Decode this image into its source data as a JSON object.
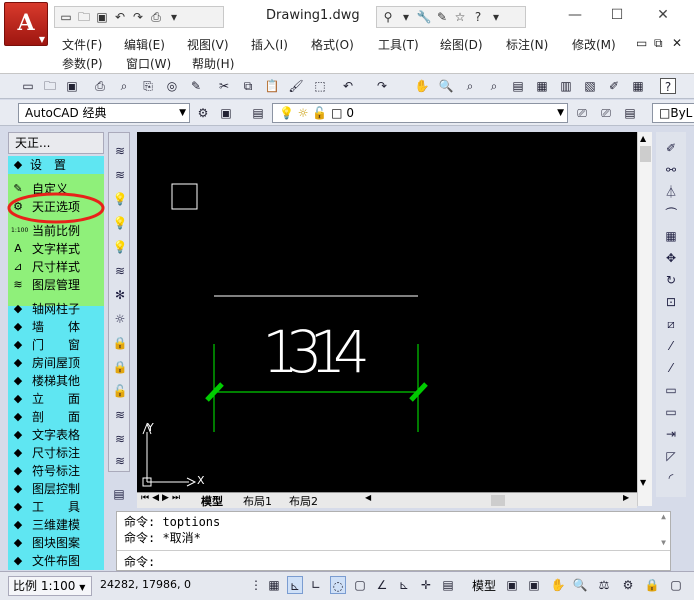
{
  "window": {
    "title": "Drawing1.dwg",
    "logo_letter": "A"
  },
  "menubar": {
    "row1": [
      "文件(F)",
      "编辑(E)",
      "视图(V)",
      "插入(I)",
      "格式(O)",
      "工具(T)",
      "绘图(D)",
      "标注(N)",
      "修改(M)"
    ],
    "row2": [
      "参数(P)",
      "窗口(W)",
      "帮助(H)"
    ]
  },
  "toolbar2": {
    "workspace": "AutoCAD 经典",
    "layer_value": "0",
    "linetype_partial": "ByL"
  },
  "palette": {
    "title": "天正...",
    "items": [
      {
        "label": "设　置",
        "icon": "expand-icon",
        "color": "#5fe6f2"
      },
      {
        "label": "自定义",
        "icon": "customize-icon"
      },
      {
        "label": "天正选项",
        "icon": "options-icon",
        "highlight": true
      },
      {
        "label": "当前比例",
        "icon": "scale-icon"
      },
      {
        "label": "文字样式",
        "icon": "text-style-icon"
      },
      {
        "label": "尺寸样式",
        "icon": "dim-style-icon"
      },
      {
        "label": "图层管理",
        "icon": "layer-manage-icon"
      },
      {
        "label": "轴网柱子"
      },
      {
        "label": "墙　　体"
      },
      {
        "label": "门　　窗"
      },
      {
        "label": "房间屋顶"
      },
      {
        "label": "楼梯其他"
      },
      {
        "label": "立　　面"
      },
      {
        "label": "剖　　面"
      },
      {
        "label": "文字表格"
      },
      {
        "label": "尺寸标注"
      },
      {
        "label": "符号标注"
      },
      {
        "label": "图层控制"
      },
      {
        "label": "工　　具"
      },
      {
        "label": "三维建模"
      },
      {
        "label": "图块图案"
      },
      {
        "label": "文件布图"
      }
    ],
    "scale_icon_text": "1:100"
  },
  "drawing": {
    "dimension_text": "1314",
    "axis_y": "Y",
    "axis_x": "X",
    "colors": {
      "background": "#000000",
      "dim_line": "#00cc00",
      "tick": "#00cc00",
      "text": "#ffffff"
    }
  },
  "tabs": [
    "模型",
    "布局1",
    "布局2"
  ],
  "command": {
    "lines": [
      "命令: toptions",
      "命令: *取消*"
    ],
    "prompt": "命令:"
  },
  "status": {
    "scale": "比例 1:100",
    "coords": "24282, 17986, 0",
    "model": "模型"
  }
}
